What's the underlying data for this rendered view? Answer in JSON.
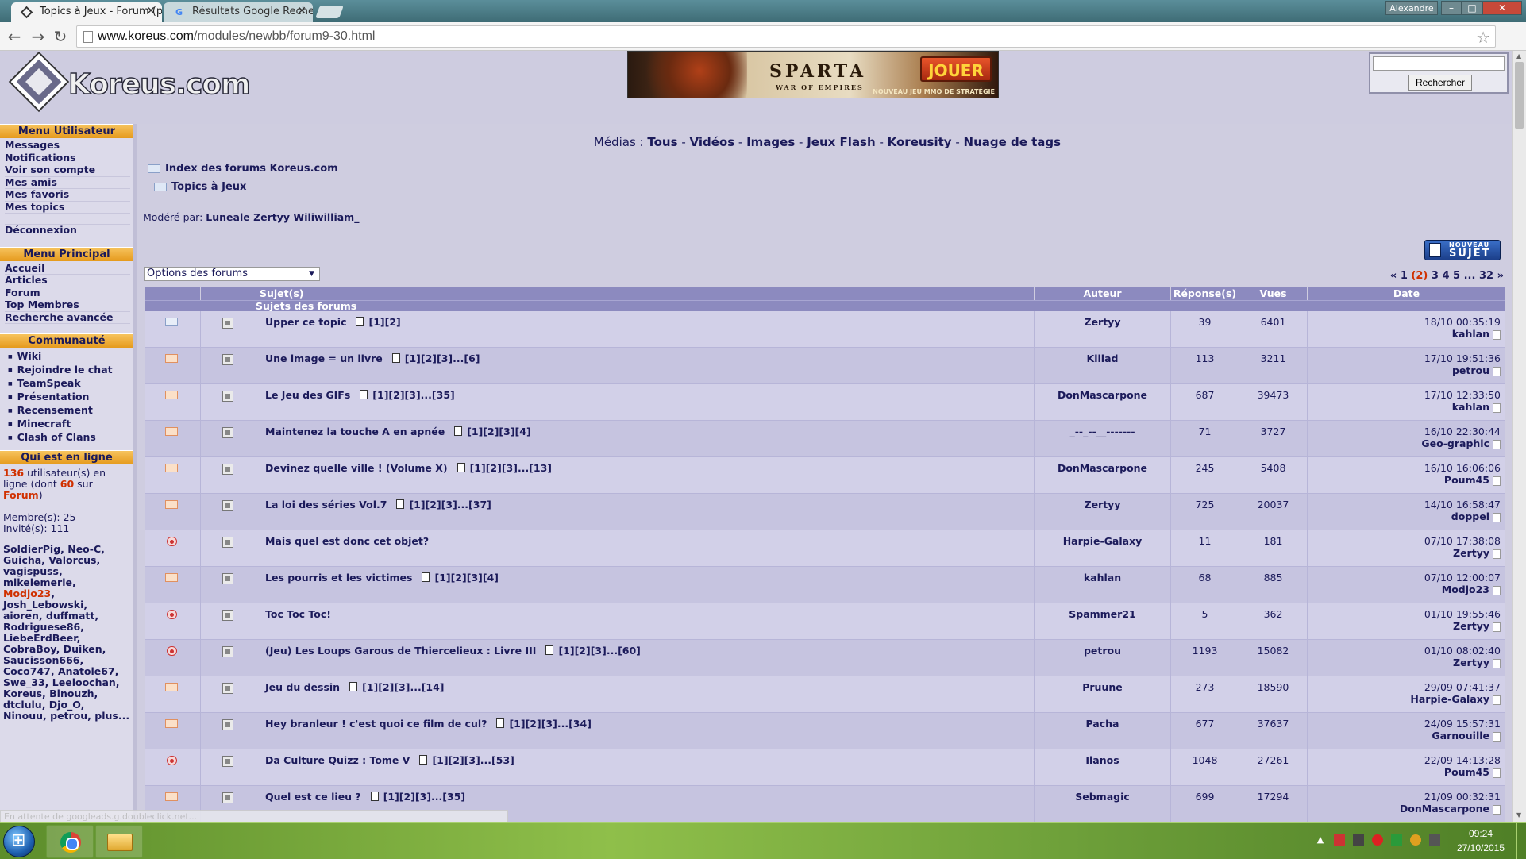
{
  "browser": {
    "tabs": [
      {
        "title": "Topics à Jeux - Forum (pa",
        "favicon": "koreus-icon"
      },
      {
        "title": "Résultats Google Recherc",
        "favicon": "google-icon"
      }
    ],
    "window_user": "Alexandre",
    "window_buttons": {
      "min": "–",
      "max": "□",
      "close": "✕"
    },
    "url_host": "www.koreus.com",
    "url_path": "/modules/newbb/forum9-30.html"
  },
  "header": {
    "logo_text": "Koreus.com",
    "banner": {
      "title": "SPARTA",
      "subtitle": "WAR OF EMPIRES",
      "cta": "JOUER",
      "tagline": "NOUVEAU JEU MMO DE STRATÉGIE"
    },
    "search_button": "Rechercher",
    "search_value": ""
  },
  "sidebar": {
    "menu_user": {
      "title": "Menu Utilisateur",
      "items": [
        "Messages",
        "Notifications",
        "Voir son compte",
        "Mes amis",
        "Mes favoris",
        "Mes topics"
      ],
      "logout": "Déconnexion"
    },
    "menu_main": {
      "title": "Menu Principal",
      "items": [
        "Accueil",
        "Articles",
        "Forum",
        "Top Membres",
        "Recherche avancée"
      ]
    },
    "community": {
      "title": "Communauté",
      "items": [
        "Wiki",
        "Rejoindre le chat",
        "TeamSpeak",
        "Présentation",
        "Recensement",
        "Minecraft",
        "Clash of Clans"
      ]
    },
    "online": {
      "title": "Qui est en ligne",
      "count": "136",
      "count_text": "utilisateur(s) en ligne",
      "dont_pre": "(dont",
      "dont_count": "60",
      "dont_mid": "sur",
      "dont_link": "Forum",
      "dont_post": ")",
      "members": "Membre(s): 25",
      "guests": "Invité(s): 111",
      "names_a": "SoldierPig, Neo-C, Guicha, Valorcus, vagispuss, mikelemerle,",
      "names_hl": "Modjo23",
      "names_b": ", Josh_Lebowski, aioren, duffmatt, Rodriguese86, LiebeErdBeer, CobraBoy, Duiken, Saucisson666, Coco747, Anatole67, Swe_33, Leeloochan, Koreus, Binouzh, dtclulu, Djo_O, Ninouu, petrou, plus..."
    }
  },
  "main": {
    "medias": {
      "label": "Médias :",
      "links": [
        "Tous",
        "Vidéos",
        "Images",
        "Jeux Flash",
        "Koreusity",
        "Nuage de tags"
      ],
      "sep": " - "
    },
    "breadcrumb": [
      "Index des forums Koreus.com",
      "Topics à Jeux"
    ],
    "moderated_label": "Modéré par:",
    "moderators": "Luneale Zertyy Wiliwilliam_",
    "new_topic": {
      "line1": "NOUVEAU",
      "line2": "SUJET"
    },
    "forum_options": "Options des forums",
    "pager": {
      "prev": "«",
      "pages": [
        "1",
        "(2)",
        "3",
        "4",
        "5",
        "...",
        "32"
      ],
      "next": "»"
    },
    "table": {
      "headers": [
        "",
        "",
        "Sujet(s)",
        "Auteur",
        "Réponse(s)",
        "Vues",
        "Date"
      ],
      "section": "Sujets des forums",
      "rows": [
        {
          "icon": "read",
          "subject": "Upper ce topic",
          "pages": "[1][2]",
          "author": "Zertyy",
          "replies": "39",
          "views": "6401",
          "date": "18/10 00:35:19",
          "last": "kahlan"
        },
        {
          "icon": "hot",
          "subject": "Une image = un livre",
          "pages": "[1][2][3]...[6]",
          "author": "Kiliad",
          "replies": "113",
          "views": "3211",
          "date": "17/10 19:51:36",
          "last": "petrou"
        },
        {
          "icon": "hot",
          "subject": "Le Jeu des GIFs",
          "pages": "[1][2][3]...[35]",
          "author": "DonMascarpone",
          "replies": "687",
          "views": "39473",
          "date": "17/10 12:33:50",
          "last": "kahlan"
        },
        {
          "icon": "hot",
          "subject": "Maintenez la touche A en apnée",
          "pages": "[1][2][3][4]",
          "author": "_--_--__-------",
          "replies": "71",
          "views": "3727",
          "date": "16/10 22:30:44",
          "last": "Geo-graphic"
        },
        {
          "icon": "hot",
          "subject": "Devinez quelle ville ! (Volume X)",
          "pages": "[1][2][3]...[13]",
          "author": "DonMascarpone",
          "replies": "245",
          "views": "5408",
          "date": "16/10 16:06:06",
          "last": "Poum45"
        },
        {
          "icon": "hot",
          "subject": "La loi des séries Vol.7",
          "pages": "[1][2][3]...[37]",
          "author": "Zertyy",
          "replies": "725",
          "views": "20037",
          "date": "14/10 16:58:47",
          "last": "doppel"
        },
        {
          "icon": "lock",
          "subject": "Mais quel est donc cet objet?",
          "pages": "",
          "author": "Harpie-Galaxy",
          "replies": "11",
          "views": "181",
          "date": "07/10 17:38:08",
          "last": "Zertyy"
        },
        {
          "icon": "hot",
          "subject": "Les pourris et les victimes",
          "pages": "[1][2][3][4]",
          "author": "kahlan",
          "replies": "68",
          "views": "885",
          "date": "07/10 12:00:07",
          "last": "Modjo23"
        },
        {
          "icon": "lock",
          "subject": "Toc Toc Toc!",
          "pages": "",
          "author": "Spammer21",
          "replies": "5",
          "views": "362",
          "date": "01/10 19:55:46",
          "last": "Zertyy"
        },
        {
          "icon": "lock",
          "subject": "(Jeu) Les Loups Garous de Thiercelieux : Livre III",
          "pages": "[1][2][3]...[60]",
          "author": "petrou",
          "replies": "1193",
          "views": "15082",
          "date": "01/10 08:02:40",
          "last": "Zertyy"
        },
        {
          "icon": "hot",
          "subject": "Jeu du dessin",
          "pages": "[1][2][3]...[14]",
          "author": "Pruune",
          "replies": "273",
          "views": "18590",
          "date": "29/09 07:41:37",
          "last": "Harpie-Galaxy"
        },
        {
          "icon": "hot",
          "subject": "Hey branleur ! c'est quoi ce film de cul?",
          "pages": "[1][2][3]...[34]",
          "author": "Pacha",
          "replies": "677",
          "views": "37637",
          "date": "24/09 15:57:31",
          "last": "Garnouille"
        },
        {
          "icon": "lock",
          "subject": "Da Culture Quizz : Tome V",
          "pages": "[1][2][3]...[53]",
          "author": "Ilanos",
          "replies": "1048",
          "views": "27261",
          "date": "22/09 14:13:28",
          "last": "Poum45"
        },
        {
          "icon": "hot",
          "subject": "Quel est ce lieu ?",
          "pages": "[1][2][3]...[35]",
          "author": "Sebmagic",
          "replies": "699",
          "views": "17294",
          "date": "21/09 00:32:31",
          "last": "DonMascarpone"
        }
      ]
    }
  },
  "statusbar": "En attente de googleads.g.doubleclick.net...",
  "taskbar": {
    "time": "09:24",
    "date": "27/10/2015",
    "tray_arrow": "▲"
  }
}
